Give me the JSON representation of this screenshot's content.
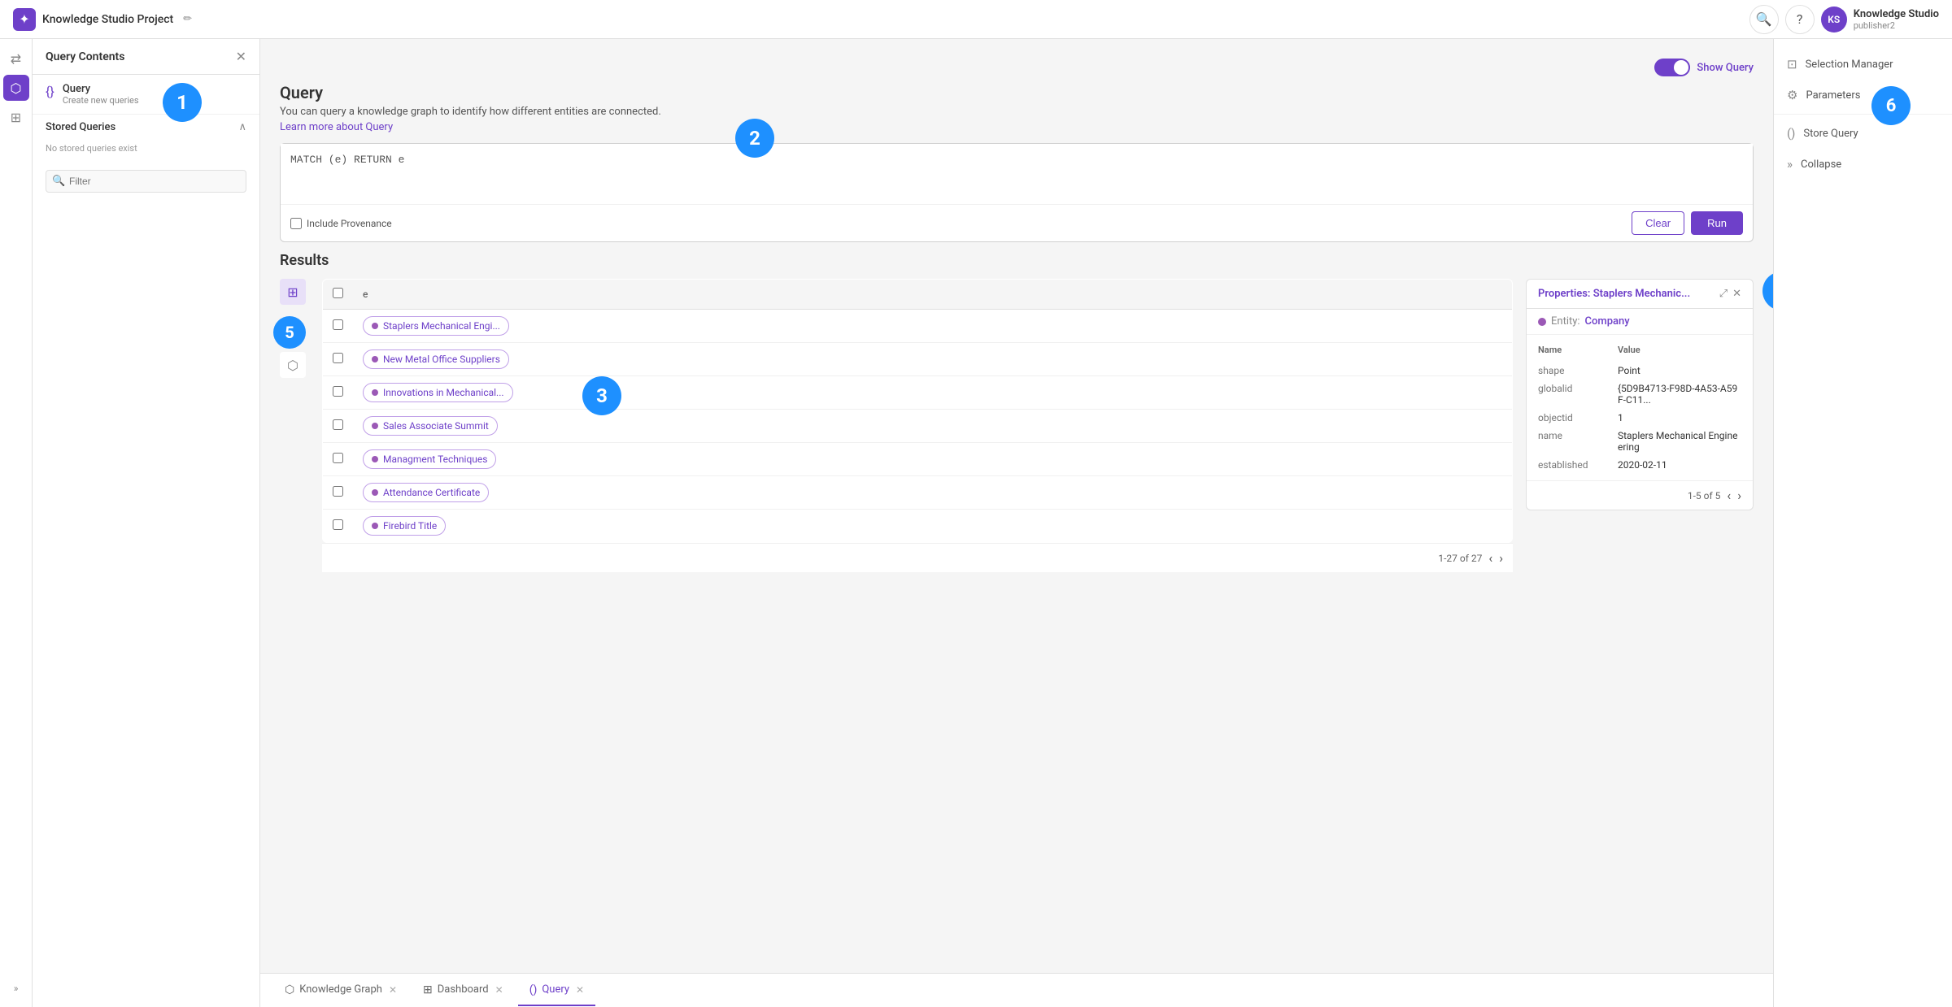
{
  "app": {
    "title": "Knowledge Studio Project",
    "user": {
      "initials": "KS",
      "name": "Knowledge Studio",
      "subtitle": "publisher2"
    }
  },
  "sidebar": {
    "title": "Query Contents",
    "items": [
      {
        "id": "query",
        "icon": "{}",
        "label": "Query",
        "sub": "Create new queries"
      },
      {
        "id": "stored-queries",
        "icon": "📁",
        "label": "Stored Queries",
        "sub": "No stored queries exist"
      }
    ],
    "filter_placeholder": "Filter"
  },
  "right_panel": {
    "items": [
      {
        "id": "selection-manager",
        "label": "Selection Manager",
        "icon": "⚙"
      },
      {
        "id": "parameters",
        "label": "Parameters",
        "icon": "⚙"
      },
      {
        "id": "store-query",
        "label": "Store Query",
        "icon": "()"
      },
      {
        "id": "collapse",
        "label": "Collapse",
        "icon": ">>"
      }
    ]
  },
  "query": {
    "title": "Query",
    "description": "You can query a knowledge graph to identify how different entities are connected.",
    "learn_more": "Learn more about Query",
    "toggle_label": "Show Query",
    "editor_value": "MATCH (e) RETURN e",
    "include_provenance_label": "Include Provenance",
    "clear_label": "Clear",
    "run_label": "Run"
  },
  "results": {
    "title": "Results",
    "column_e": "e",
    "rows": [
      {
        "id": 1,
        "label": "Staplers Mechanical Engi..."
      },
      {
        "id": 2,
        "label": "New Metal Office Suppliers"
      },
      {
        "id": 3,
        "label": "Innovations in Mechanical..."
      },
      {
        "id": 4,
        "label": "Sales Associate Summit"
      },
      {
        "id": 5,
        "label": "Managment Techniques"
      },
      {
        "id": 6,
        "label": "Attendance Certificate"
      },
      {
        "id": 7,
        "label": "Firebird Title"
      }
    ],
    "pagination": "1-27 of 27"
  },
  "properties": {
    "title": "Properties:",
    "entity_label": "Staplers Mechanic...",
    "entity_type_label": "Entity:",
    "entity_type": "Company",
    "header_name": "Name",
    "header_value": "Value",
    "rows": [
      {
        "key": "shape",
        "value": "Point"
      },
      {
        "key": "globalid",
        "value": "{5D9B4713-F98D-4A53-A59F-C11..."
      },
      {
        "key": "objectid",
        "value": "1"
      },
      {
        "key": "name",
        "value": "Staplers Mechanical Engineering"
      },
      {
        "key": "established",
        "value": "2020-02-11"
      }
    ],
    "pagination": "1-5 of 5"
  },
  "bottom_tabs": [
    {
      "id": "knowledge-graph",
      "icon": "⬡",
      "label": "Knowledge Graph",
      "active": false
    },
    {
      "id": "dashboard",
      "icon": "⊞",
      "label": "Dashboard",
      "active": false
    },
    {
      "id": "query",
      "icon": "()",
      "label": "Query",
      "active": true
    }
  ]
}
